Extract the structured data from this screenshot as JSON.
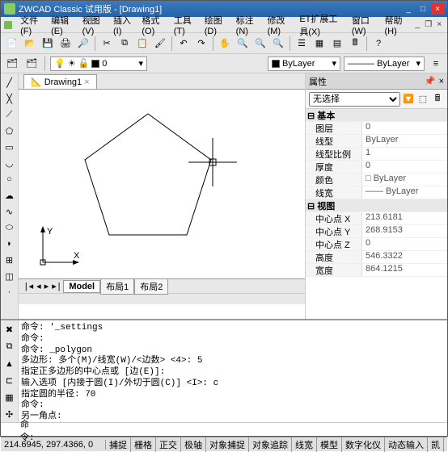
{
  "window": {
    "title": "ZWCAD Classic 试用版 - [Drawing1]"
  },
  "menu": [
    "文件(F)",
    "编辑(E)",
    "视图(V)",
    "插入(I)",
    "格式(O)",
    "工具(T)",
    "绘图(D)",
    "标注(N)",
    "修改(M)",
    "ET扩展工具(X)",
    "窗口(W)",
    "帮助(H)"
  ],
  "layer": {
    "name": "0",
    "bylayer": "ByLayer",
    "bylayer2": "ByLayer"
  },
  "doc_tab": "Drawing1",
  "model_tabs": {
    "active": "Model",
    "layouts": [
      "布局1",
      "布局2"
    ]
  },
  "properties": {
    "title": "属性",
    "selector": "无选择",
    "groups": [
      {
        "name": "基本",
        "rows": [
          {
            "k": "图层",
            "v": "0"
          },
          {
            "k": "线型",
            "v": "ByLayer"
          },
          {
            "k": "线型比例",
            "v": "1"
          },
          {
            "k": "厚度",
            "v": "0"
          },
          {
            "k": "颜色",
            "v": "□ ByLayer"
          },
          {
            "k": "线宽",
            "v": "—— ByLayer"
          }
        ]
      },
      {
        "name": "视图",
        "rows": [
          {
            "k": "中心点 X",
            "v": "213.6181"
          },
          {
            "k": "中心点 Y",
            "v": "268.9153"
          },
          {
            "k": "中心点 Z",
            "v": "0"
          },
          {
            "k": "高度",
            "v": "546.3322"
          },
          {
            "k": "宽度",
            "v": "864.1215"
          }
        ]
      }
    ]
  },
  "command": {
    "history": "命令: '_settings\n命令:\n命令: _polygon\n多边形: 多个(M)/线宽(W)/<边数> <4>: 5\n指定正多边形的中心点或 [边(E)]:\n输入选项 [内接于圆(I)/外切于圆(C)] <I>: c\n指定圆的半径: 70\n命令:\n另一角点:",
    "prompt": "命令:"
  },
  "status": {
    "coords": "214.6945, 297.4366, 0",
    "buttons": [
      "捕捉",
      "栅格",
      "正交",
      "极轴",
      "对象捕捉",
      "对象追踪",
      "线宽",
      "模型",
      "数字化仪",
      "动态输入",
      "凯"
    ]
  },
  "icons": {
    "new": "📄",
    "open": "📂",
    "save": "💾",
    "print": "🖨",
    "cut": "✂",
    "copy": "⧉",
    "paste": "📋",
    "undo": "↶",
    "redo": "↷",
    "pan": "✋",
    "zoom": "🔍",
    "help": "?"
  }
}
